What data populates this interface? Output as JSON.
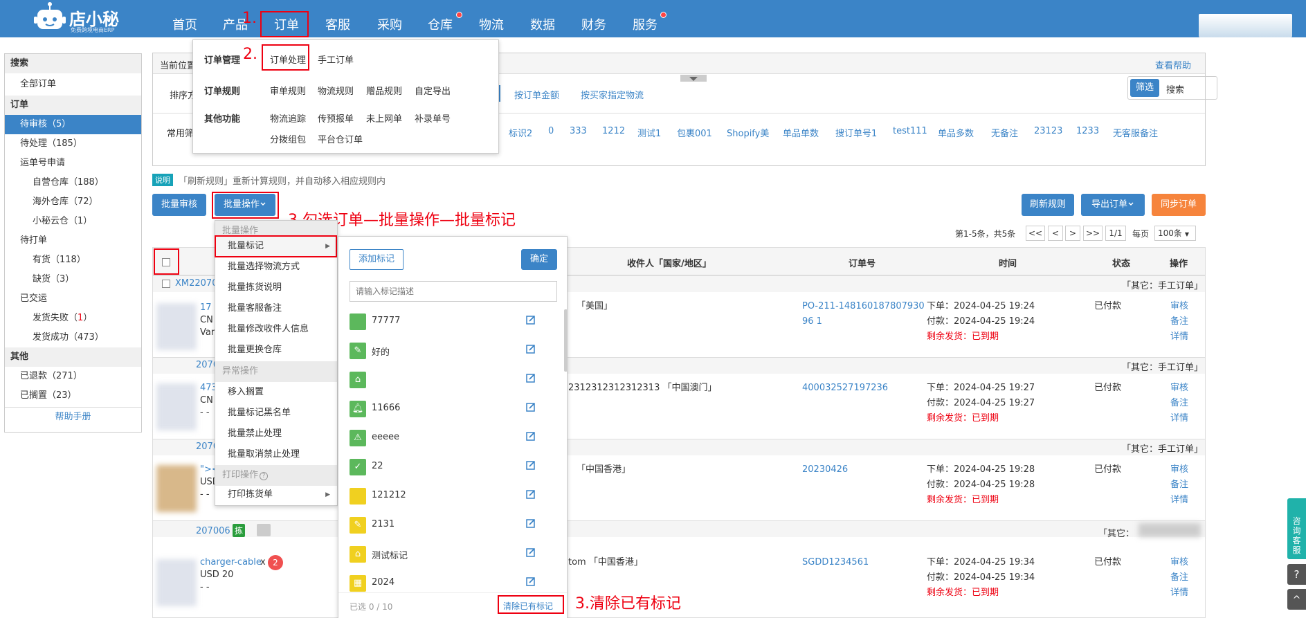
{
  "brand": {
    "name": "店小秘",
    "tagline": "免费跨境电商ERP"
  },
  "nav": [
    {
      "label": "首页"
    },
    {
      "label": "产品"
    },
    {
      "label": "订单"
    },
    {
      "label": "客服"
    },
    {
      "label": "采购"
    },
    {
      "label": "仓库"
    },
    {
      "label": "物流"
    },
    {
      "label": "数据"
    },
    {
      "label": "财务"
    },
    {
      "label": "服务"
    }
  ],
  "annotations": {
    "a1": "1.",
    "a2": "2.",
    "a3": "3.勾选订单—批量操作—批量标记",
    "a4": "3.清除已有标记"
  },
  "order_menu": {
    "group1_title": "订单管理",
    "group1_items": [
      "订单处理",
      "手工订单"
    ],
    "group2_title": "订单规则",
    "group2_items": [
      "审单规则",
      "物流规则",
      "赠品规则",
      "自定导出"
    ],
    "group3_title": "其他功能",
    "group3_items": [
      "物流追踪",
      "传预报单",
      "未上网单",
      "补录单号",
      "分拨组包",
      "平台仓订单"
    ]
  },
  "sidebar": {
    "search": "搜索",
    "all_orders": "全部订单",
    "orders": "订单",
    "pending_review": "待审核",
    "pending_review_count": "（5）",
    "pending": "待处理",
    "pending_count": "（185）",
    "tracking_apply": "运单号申请",
    "own_wh": "自营仓库",
    "own_wh_count": "（188）",
    "overseas_wh": "海外仓库",
    "overseas_wh_count": "（72）",
    "cloud_wh": "小秘云仓",
    "cloud_wh_count": "（1）",
    "to_print": "待打单",
    "in_stock": "有货",
    "in_stock_count": "（118）",
    "out_stock": "缺货",
    "out_stock_count": "（3）",
    "shipped": "已交运",
    "ship_fail": "发货失败",
    "ship_fail_count_open": "（",
    "ship_fail_count": "1",
    "ship_fail_count_close": "）",
    "ship_ok": "发货成功",
    "ship_ok_count": "（473）",
    "other": "其他",
    "refunded": "已退款",
    "refunded_count": "（271）",
    "held": "已搁置",
    "held_count": "（23）",
    "help": "帮助手册"
  },
  "header": {
    "breadcrumb": "当前位置",
    "help_link": "查看帮助",
    "sort_label": "排序方",
    "sort_options": [
      "按订单金额",
      "按买家指定物流"
    ],
    "filter_btn": "筛选",
    "search_btn": "搜索",
    "common_filter_label": "常用筛",
    "common_filters": [
      "标识2",
      "0",
      "333",
      "1212",
      "测试1",
      "包裹001",
      "Shopify美",
      "单品单数",
      "搜订单号1",
      "test111",
      "单品多数",
      "无备注",
      "23123",
      "1233",
      "无客服备注"
    ]
  },
  "notice": {
    "tag": "说明",
    "text": "「刷新规则」重新计算规则，并自动移入相应规则内"
  },
  "toolbar": {
    "batch_review": "批量审核",
    "batch_ops": "批量操作",
    "refresh_rules": "刷新规则",
    "export_orders": "导出订单",
    "sync_orders": "同步订单"
  },
  "pagination": {
    "summary": "第1-5条，共5条",
    "first": "<<",
    "prev": "<",
    "next": ">",
    "last": ">>",
    "page": "1/1",
    "per_page_label": "每页",
    "per_page": "100条"
  },
  "table": {
    "headers": {
      "receiver": "收件人「国家/地区」",
      "order_no": "订单号",
      "time": "时间",
      "status": "状态",
      "action": "操作"
    },
    "rows": [
      {
        "id": "XM22070",
        "group_tag": "「其它：手工订单」",
        "prod": "17",
        "prod2": "CN",
        "prod3": "Vari",
        "receiver": "「美国」",
        "order_no": "PO-211-14816018780793096 1",
        "t1": "下单：2024-04-25 19:24",
        "t2": "付款：2024-04-25 19:24",
        "t3": "剩余发货：已到期",
        "status": "已付款",
        "a1": "审核",
        "a2": "备注",
        "a3": "详情"
      },
      {
        "id": "2070",
        "group_tag": "「其它：手工订单」",
        "prod": "473",
        "prod2": "CN",
        "prod3": "- -",
        "receiver": "2312312312312313 「中国澳门」",
        "order_no": "400032527197236",
        "t1": "下单：2024-04-25 19:27",
        "t2": "付款：2024-04-25 19:27",
        "t3": "剩余发货：已到期",
        "status": "已付款",
        "a1": "审核",
        "a2": "备注",
        "a3": "详情"
      },
      {
        "id": "2070",
        "group_tag": "「其它：手工订单」",
        "prod": "\"><",
        "prod2": "USD",
        "prod3": "- -",
        "receiver": "「中国香港」",
        "order_no": "20230426",
        "t1": "下单：2024-04-25 19:28",
        "t2": "付款：2024-04-25 19:28",
        "t3": "剩余发货：已到期",
        "status": "已付款",
        "a1": "审核",
        "a2": "备注",
        "a3": "详情"
      },
      {
        "id": "207006",
        "group_tag": "「其它：",
        "badge": "拣",
        "prod": "charger-cable",
        "qty_x": "x",
        "qty": "2",
        "prod2": "USD 20",
        "prod3": "- -",
        "receiver": "tom 「中国香港」",
        "order_no": "SGDD1234561",
        "t1": "下单：2024-04-25 19:34",
        "t2": "付款：2024-04-25 19:34",
        "t3": "剩余发货：已到期",
        "status": "已付款",
        "a1": "审核",
        "a2": "备注",
        "a3": "详情"
      }
    ]
  },
  "batch_menu": {
    "sec1": "批量操作",
    "items1": [
      "批量标记",
      "批量选择物流方式",
      "批量拣货说明",
      "批量客服备注",
      "批量修改收件人信息",
      "批量更换仓库"
    ],
    "sec2": "异常操作",
    "items2": [
      "移入搁置",
      "批量标记黑名单",
      "批量禁止处理",
      "批量取消禁止处理"
    ],
    "sec3": "打印操作",
    "items3": [
      "打印拣货单"
    ]
  },
  "mark_panel": {
    "add_btn": "添加标记",
    "confirm_btn": "确定",
    "search_placeholder": "请输入标记描述",
    "items": [
      {
        "label": "77777",
        "color": "#5cb85c",
        "icon": ""
      },
      {
        "label": "好的",
        "color": "#5cb85c",
        "icon": "note"
      },
      {
        "label": "",
        "color": "#5cb85c",
        "icon": "house"
      },
      {
        "label": "11666",
        "color": "#5cb85c",
        "icon": "bell"
      },
      {
        "label": "eeeee",
        "color": "#5cb85c",
        "icon": "warning"
      },
      {
        "label": "22",
        "color": "#5cb85c",
        "icon": "check"
      },
      {
        "label": "121212",
        "color": "#f0d020",
        "icon": ""
      },
      {
        "label": "2131",
        "color": "#f0d020",
        "icon": "note"
      },
      {
        "label": "测试标记",
        "color": "#f0d020",
        "icon": "house"
      },
      {
        "label": "2024",
        "color": "#f0d020",
        "icon": "grid"
      }
    ],
    "selected": "已选 0 / 10",
    "clear": "清除已有标记"
  },
  "float": {
    "service": "咨询客服",
    "help": "?",
    "top": "^"
  }
}
